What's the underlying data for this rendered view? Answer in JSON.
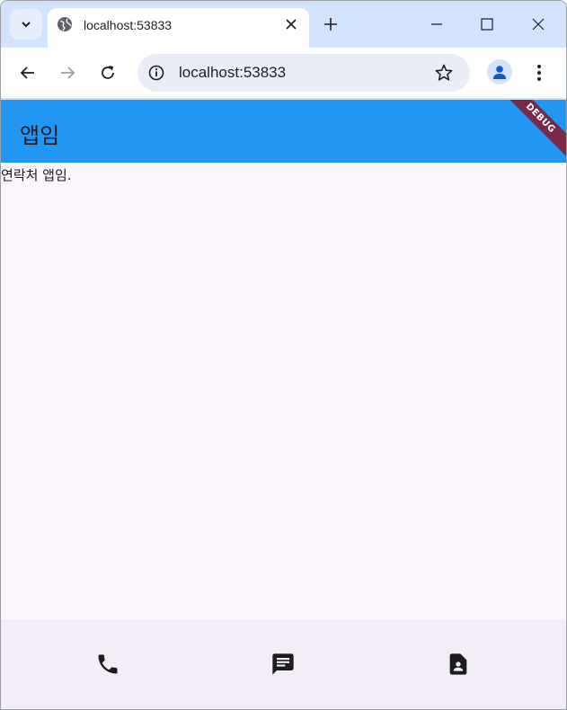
{
  "browser": {
    "tab": {
      "title": "localhost:53833"
    },
    "omnibox": {
      "url": "localhost:53833"
    }
  },
  "app": {
    "appbar_title": "앱임",
    "debug_banner": "DEBUG",
    "body_text": "연락처 앱임.",
    "bottom_nav": [
      {
        "icon": "phone-icon"
      },
      {
        "icon": "message-icon"
      },
      {
        "icon": "contact-icon"
      }
    ]
  },
  "colors": {
    "tabstrip": "#d3e3fd",
    "appbar": "#2196f3",
    "app_background": "#fdf7fd",
    "bottom_nav": "#f3edf7",
    "debug_banner": "#7b2a45"
  }
}
